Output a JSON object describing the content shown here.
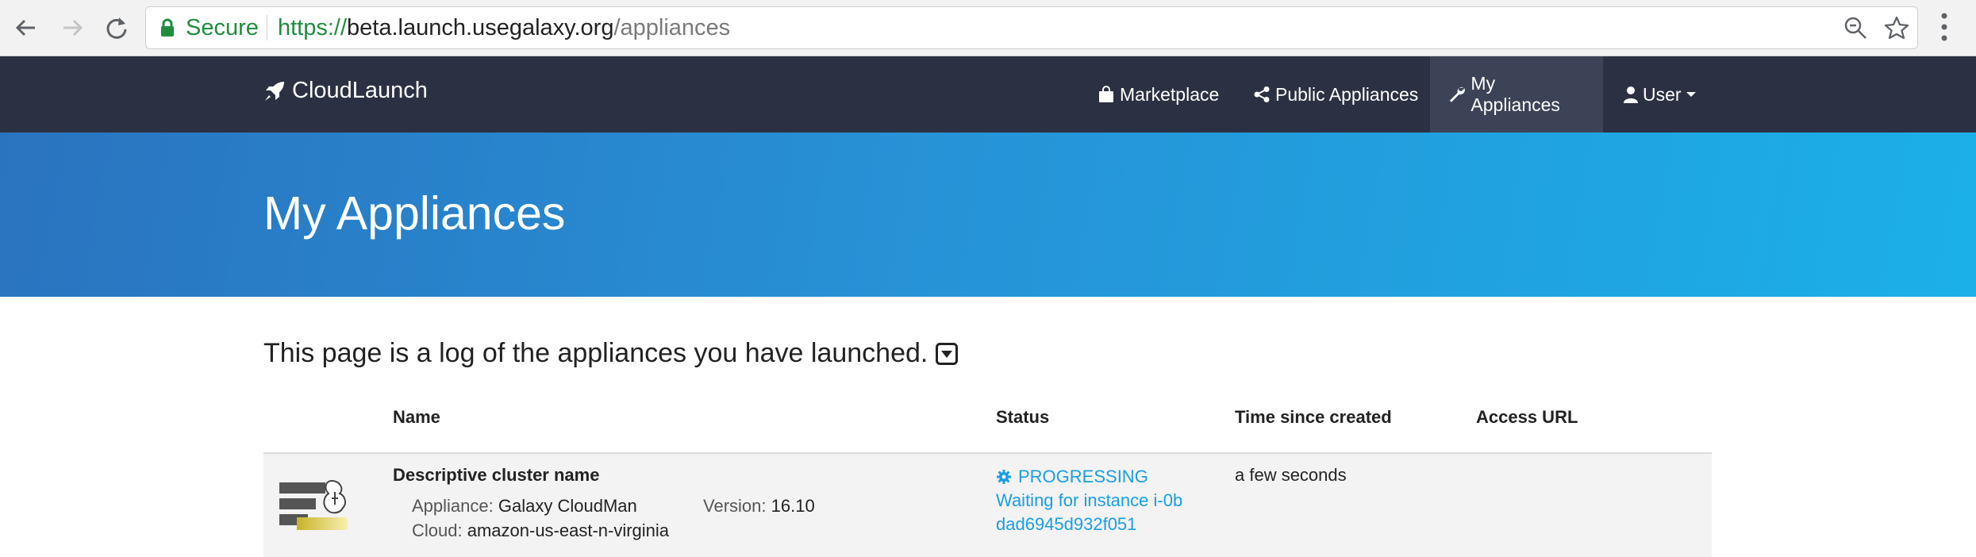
{
  "browser": {
    "secure_label": "Secure",
    "url_scheme": "https://",
    "url_host": "beta.launch.usegalaxy.org",
    "url_path": "/appliances"
  },
  "navbar": {
    "brand": "CloudLaunch",
    "items": [
      {
        "label": "Marketplace",
        "icon": "shopping-bag-icon"
      },
      {
        "label": "Public Appliances",
        "icon": "share-icon"
      },
      {
        "label": "My Appliances",
        "icon": "wrench-icon",
        "active": true
      },
      {
        "label": "User",
        "icon": "user-icon"
      }
    ]
  },
  "hero": {
    "title": "My Appliances"
  },
  "intro": {
    "text": "This page is a log of the appliances you have launched."
  },
  "table": {
    "headers": [
      "Name",
      "Status",
      "Time since created",
      "Access URL"
    ],
    "rows": [
      {
        "name": "Descriptive cluster name",
        "appliance_label": "Appliance:",
        "appliance_value": "Galaxy CloudMan",
        "version_label": "Version:",
        "version_value": "16.10",
        "cloud_label": "Cloud:",
        "cloud_value": "amazon-us-east-n-virginia",
        "status": "PROGRESSING",
        "status_detail": "Waiting for instance i-0bdad6945d932f051",
        "time": "a few seconds",
        "access_url": ""
      }
    ]
  },
  "colors": {
    "navbar_bg": "#2b3142",
    "hero_start": "#2a73bf",
    "hero_end": "#1bb0e8",
    "status_link": "#1a9ee5",
    "secure_green": "#1e8e3e"
  }
}
